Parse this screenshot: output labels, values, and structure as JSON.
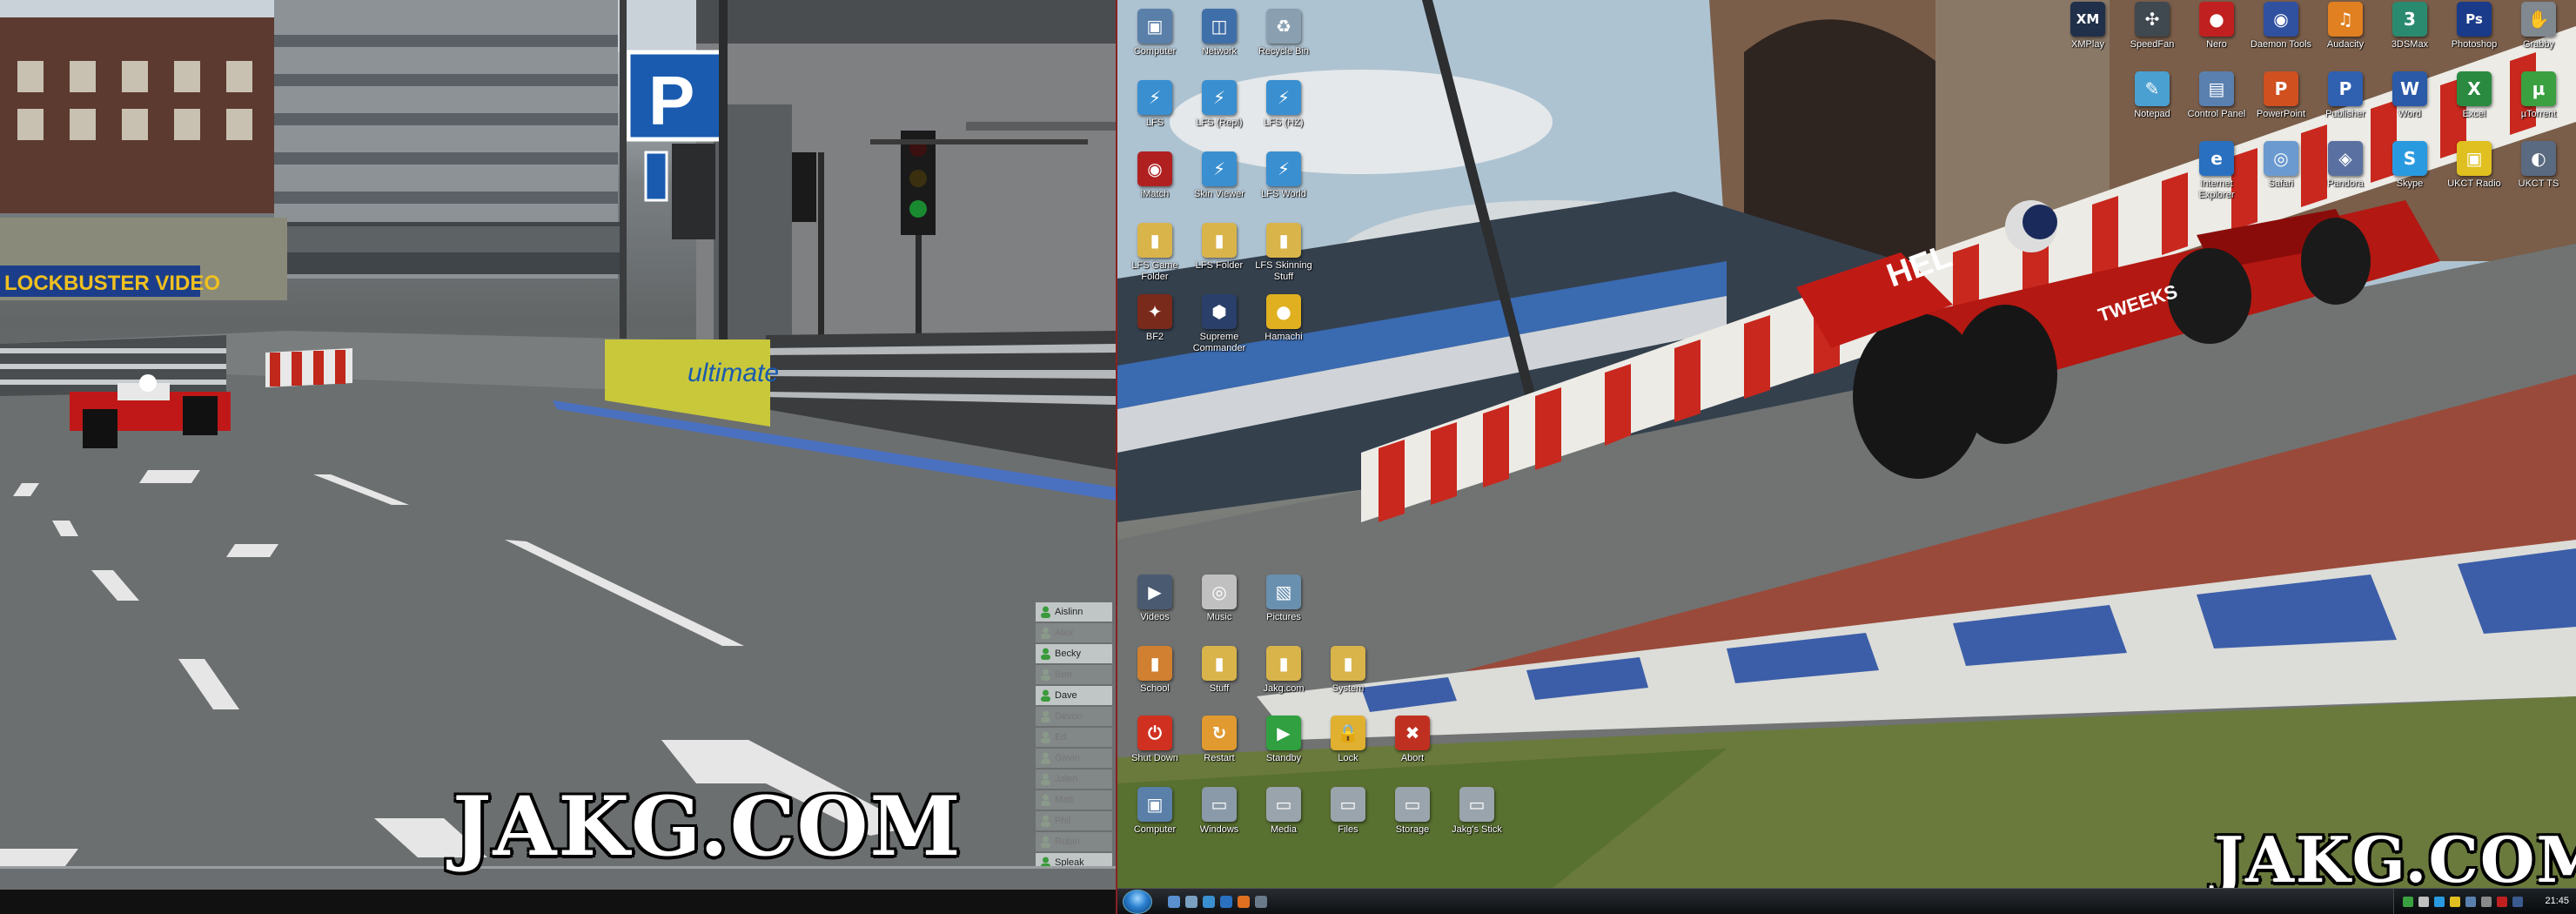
{
  "game": {
    "players": [
      {
        "name": "Aislinn",
        "state": "active"
      },
      {
        "name": "Alex",
        "state": "idle"
      },
      {
        "name": "Becky",
        "state": "active"
      },
      {
        "name": "Ben",
        "state": "idle"
      },
      {
        "name": "Dave",
        "state": "active"
      },
      {
        "name": "Devon",
        "state": "idle"
      },
      {
        "name": "Ed",
        "state": "idle"
      },
      {
        "name": "Gavin",
        "state": "idle"
      },
      {
        "name": "Jalen",
        "state": "idle"
      },
      {
        "name": "Matt",
        "state": "idle"
      },
      {
        "name": "Phil",
        "state": "idle"
      },
      {
        "name": "Robin",
        "state": "idle"
      },
      {
        "name": "Spleak",
        "state": "active"
      }
    ],
    "scene_text": {
      "parking_sign": "P",
      "shop_sign": "LOCKBUSTER VIDEO",
      "banner": "ultimate"
    },
    "watermark": "JAKG.COM"
  },
  "desktop": {
    "icons_left": [
      {
        "label": "Computer",
        "color": "#5a7fa8",
        "glyph": "▣"
      },
      {
        "label": "Network",
        "color": "#3f6fa8",
        "glyph": "◫"
      },
      {
        "label": "Recycle Bin",
        "color": "#8aa0b0",
        "glyph": "♻"
      },
      {
        "label": "LFS",
        "color": "#3a8fd0",
        "glyph": "⚡"
      },
      {
        "label": "LFS (Repl)",
        "color": "#3a8fd0",
        "glyph": "⚡"
      },
      {
        "label": "LFS (HZ)",
        "color": "#3a8fd0",
        "glyph": "⚡"
      },
      {
        "label": "iMatch",
        "color": "#b02020",
        "glyph": "◉"
      },
      {
        "label": "Skin Viewer",
        "color": "#3a8fd0",
        "glyph": "⚡"
      },
      {
        "label": "LFS World",
        "color": "#3a8fd0",
        "glyph": "⚡"
      },
      {
        "label": "LFS Game Folder",
        "color": "#d9b44a",
        "glyph": "▮"
      },
      {
        "label": "LFS Folder",
        "color": "#d9b44a",
        "glyph": "▮"
      },
      {
        "label": "LFS Skinning Stuff",
        "color": "#d9b44a",
        "glyph": "▮"
      },
      {
        "label": "BF2",
        "color": "#7a2a1a",
        "glyph": "✦"
      },
      {
        "label": "Supreme Commander",
        "color": "#2a3f6a",
        "glyph": "⬢"
      },
      {
        "label": "Hamachi",
        "color": "#e0b020",
        "glyph": "●"
      },
      {
        "label": "Videos",
        "color": "#4a5a70",
        "glyph": "▶"
      },
      {
        "label": "Music",
        "color": "#c0c0c0",
        "glyph": "◎"
      },
      {
        "label": "Pictures",
        "color": "#6a90b0",
        "glyph": "▧"
      },
      {
        "label": "School",
        "color": "#d08030",
        "glyph": "▮"
      },
      {
        "label": "Stuff",
        "color": "#d9b44a",
        "glyph": "▮"
      },
      {
        "label": "Jakg.com",
        "color": "#d9b44a",
        "glyph": "▮"
      },
      {
        "label": "System",
        "color": "#d9b44a",
        "glyph": "▮"
      },
      {
        "label": "Shut Down",
        "color": "#d03020",
        "glyph": "⏻"
      },
      {
        "label": "Restart",
        "color": "#e09a30",
        "glyph": "↻"
      },
      {
        "label": "Standby",
        "color": "#30a040",
        "glyph": "▶"
      },
      {
        "label": "Lock",
        "color": "#e0b030",
        "glyph": "🔒"
      },
      {
        "label": "Abort",
        "color": "#c03020",
        "glyph": "✖"
      },
      {
        "label": "Computer",
        "color": "#5a7fa8",
        "glyph": "▣"
      },
      {
        "label": "Windows",
        "color": "#8a9aa8",
        "glyph": "▭"
      },
      {
        "label": "Media",
        "color": "#9aa4ac",
        "glyph": "▭"
      },
      {
        "label": "Files",
        "color": "#9aa4ac",
        "glyph": "▭"
      },
      {
        "label": "Storage",
        "color": "#9aa4ac",
        "glyph": "▭"
      },
      {
        "label": "Jakg's Stick",
        "color": "#9aa4ac",
        "glyph": "▭"
      }
    ],
    "icons_right": [
      {
        "label": "XMPlay",
        "color": "#20304a",
        "glyph": "XM"
      },
      {
        "label": "SpeedFan",
        "color": "#404850",
        "glyph": "✣"
      },
      {
        "label": "Nero",
        "color": "#c02020",
        "glyph": "●"
      },
      {
        "label": "Daemon Tools",
        "color": "#3050a0",
        "glyph": "◉"
      },
      {
        "label": "Audacity",
        "color": "#e08020",
        "glyph": "♫"
      },
      {
        "label": "3DSMax",
        "color": "#2a8a70",
        "glyph": "3"
      },
      {
        "label": "Photoshop",
        "color": "#1a3a8a",
        "glyph": "Ps"
      },
      {
        "label": "Grabby",
        "color": "#808890",
        "glyph": "✋"
      },
      {
        "label": "Notepad",
        "color": "#4aa0d0",
        "glyph": "✎"
      },
      {
        "label": "Control Panel",
        "color": "#5a80b0",
        "glyph": "▤"
      },
      {
        "label": "PowerPoint",
        "color": "#d05020",
        "glyph": "P"
      },
      {
        "label": "Publisher",
        "color": "#3060b0",
        "glyph": "P"
      },
      {
        "label": "Word",
        "color": "#2a5aa8",
        "glyph": "W"
      },
      {
        "label": "Excel",
        "color": "#2a8a40",
        "glyph": "X"
      },
      {
        "label": "µTorrent",
        "color": "#3aa040",
        "glyph": "µ"
      },
      {
        "label": "Internet Explorer",
        "color": "#2a70c0",
        "glyph": "e"
      },
      {
        "label": "Safari",
        "color": "#6a9ad0",
        "glyph": "◎"
      },
      {
        "label": "Pandora",
        "color": "#5a70a0",
        "glyph": "◈"
      },
      {
        "label": "Skype",
        "color": "#2a9ae0",
        "glyph": "S"
      },
      {
        "label": "UKCT Radio",
        "color": "#e0c020",
        "glyph": "▣"
      },
      {
        "label": "UKCT TS",
        "color": "#5a6a80",
        "glyph": "◐"
      }
    ],
    "scene_text": {
      "car_sponsor": "TWEEKS",
      "wall_text": "HEL"
    },
    "watermark": "JAKG.COM",
    "taskbar": {
      "clock": "21:45"
    }
  }
}
